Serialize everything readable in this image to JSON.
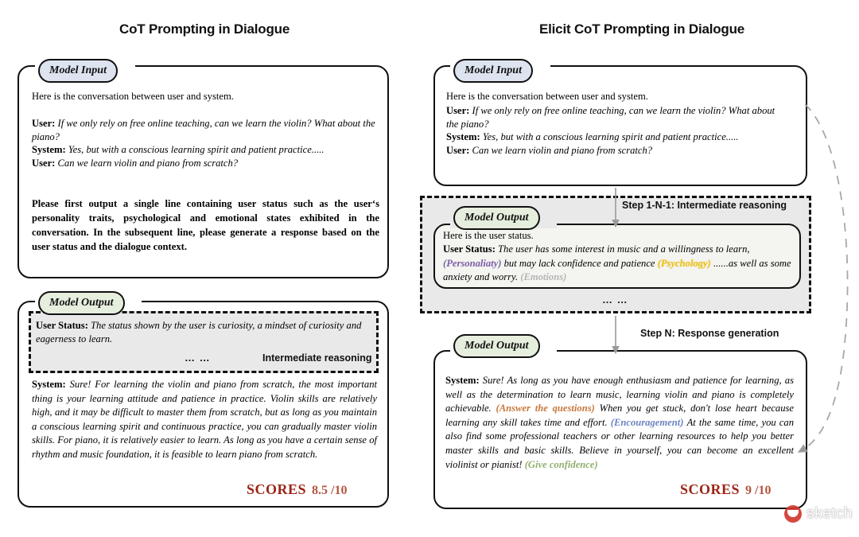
{
  "titles": {
    "left": "CoT Prompting in Dialogue",
    "right": "Elicit CoT Prompting in Dialogue"
  },
  "labels": {
    "model_input": "Model Input",
    "model_output": "Model Output",
    "intermediate_reasoning": "Intermediate reasoning",
    "ellipsis": "… …",
    "step_1": "Step 1-N-1:  Intermediate reasoning",
    "step_n": "Step N:  Response generation",
    "scores_label": "SCORES"
  },
  "left_panel": {
    "input": {
      "heading": "Here is the conversation between user and system.",
      "turns": [
        {
          "speaker": "User:",
          "text": "If we only rely on free online teaching, can we learn the violin? What about the piano?"
        },
        {
          "speaker": "System:",
          "text": "Yes, but with a conscious learning spirit and patient practice....."
        },
        {
          "speaker": "User:",
          "text": "Can we learn violin and piano from scratch?"
        }
      ],
      "instruction": "Please first output a single line containing user status such as the user‘s personality traits, psychological and emotional states exhibited in the conversation. In the subsequent line, please generate a response based on the user status and the dialogue context."
    },
    "output": {
      "status_speaker": "User Status:",
      "status_text": "The status shown by the user is curiosity, a mindset of curiosity and eagerness to learn.",
      "system_speaker": "System:",
      "system_text": "Sure! For learning the violin and piano from scratch, the most important thing is your learning attitude and patience in practice. Violin skills are relatively high, and it may be difficult to master them from scratch, but as long as you maintain a conscious learning spirit and continuous practice, you can gradually master violin skills. For piano, it is relatively easier to learn. As long as you have a certain sense of rhythm and music foundation, it is feasible to learn piano from scratch.",
      "score_value": "8.5 /10"
    }
  },
  "right_panel": {
    "input": {
      "heading": "Here is the conversation between user and system.",
      "turns": [
        {
          "speaker": "User:",
          "text": "If we only rely on free online teaching, can we learn the violin? What about the piano?"
        },
        {
          "speaker": "System:",
          "text": "Yes, but with a conscious learning spirit and patient practice....."
        },
        {
          "speaker": "User:",
          "text": "Can we learn violin and piano from scratch?"
        }
      ]
    },
    "reasoning_output": {
      "heading": "Here is the user status.",
      "status_speaker": "User Status:",
      "status_seg_1": "The user has some interest in music and a willingness to learn,",
      "annotation_personality": "(Personaliaty)",
      "status_seg_2": "but may lack confidence and patience",
      "annotation_psychology": "(Psychology)",
      "status_seg_3": "......as well as some anxiety and worry.",
      "annotation_emotions": "(Emotions)"
    },
    "response_output": {
      "system_speaker": "System:",
      "seg_1": "Sure! As long as you have enough enthusiasm and patience for learning, as well as the determination to learn music, learning violin and piano is completely achievable.",
      "annotation_answer": "(Answer the questions)",
      "seg_2": "When you get stuck, don't lose heart because learning any skill takes time and effort.",
      "annotation_encouragement": "(Encouragement)",
      "seg_3": "At the same time, you can also find some professional teachers or other learning resources to help you better master skills and basic skills. Believe in yourself, you can become an excellent violinist or pianist!",
      "annotation_confidence": "(Give confidence)",
      "score_value": "9 /10"
    }
  },
  "watermark": {
    "text": "sketch"
  },
  "colors": {
    "input_tab": "#dde3ef",
    "output_tab": "#e6eede",
    "dashed_fill": "#e9e9e9",
    "scores_label": "#9c2417",
    "scores_value": "#b3553f",
    "personality": "#7b5ea7",
    "psychology": "#f0c419",
    "emotions": "#b6b6b6",
    "answer": "#c8773c",
    "encouragement": "#6b84c0",
    "confidence": "#8fae6e",
    "arrow_gray": "#9a9a9a"
  }
}
